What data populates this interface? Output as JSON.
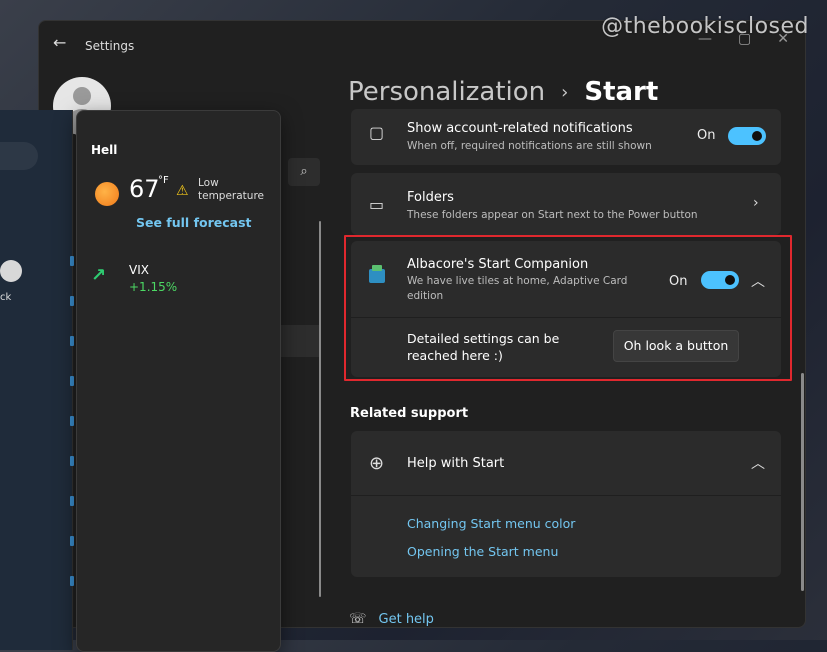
{
  "watermark": "@thebookisclosed",
  "window": {
    "title": "Settings"
  },
  "breadcrumb": {
    "parent": "Personalization",
    "separator": "›",
    "current": "Start"
  },
  "settings": {
    "account_notifications": {
      "title": "Show account-related notifications",
      "subtitle": "When off, required notifications are still shown",
      "toggle_label": "On"
    },
    "folders": {
      "title": "Folders",
      "subtitle": "These folders appear on Start next to the Power button"
    },
    "companion": {
      "title": "Albacore's Start Companion",
      "subtitle": "We have live tiles at home, Adaptive Card edition",
      "toggle_label": "On",
      "detail_text": "Detailed settings can be reached here :)",
      "button_label": "Oh look a button"
    }
  },
  "related_support": {
    "heading": "Related support",
    "help_title": "Help with Start",
    "links": [
      "Changing Start menu color",
      "Opening the Start menu"
    ]
  },
  "get_help": "Get help",
  "widgets": {
    "location": "Hell",
    "temperature": "67",
    "unit": "°F",
    "warning": "Low temperature",
    "forecast_link": "See full forecast",
    "stock": {
      "name": "VIX",
      "change": "+1.15%"
    }
  },
  "start_panel": {
    "partial_label": "ck"
  },
  "colors": {
    "accent": "#4cc2ff",
    "link": "#73c6f0",
    "highlight": "#e0282e",
    "positive": "#4cd964"
  }
}
